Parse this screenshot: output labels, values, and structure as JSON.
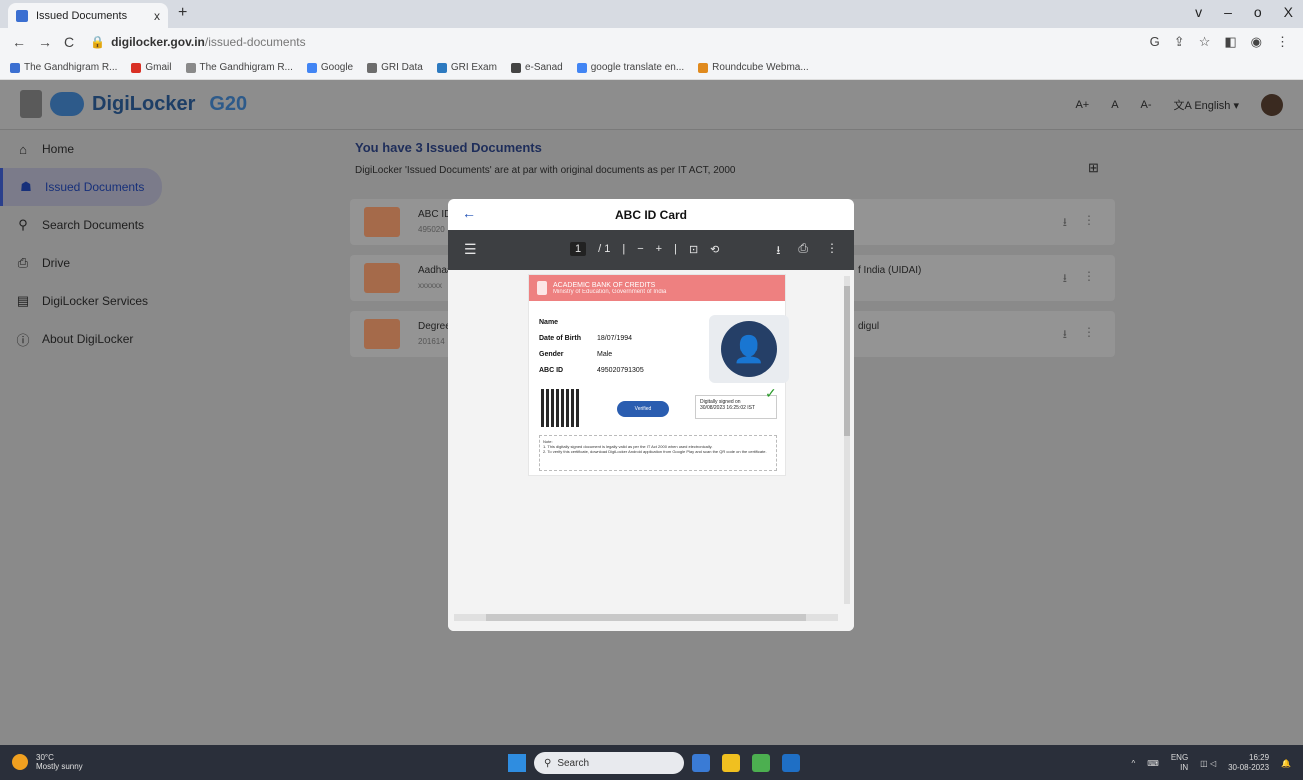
{
  "browser": {
    "tab_title": "Issued Documents",
    "tab_close": "x",
    "new_tab": "+",
    "window_controls": [
      "v",
      "–",
      "o",
      "X"
    ],
    "url_host": "digilocker.gov.in",
    "url_path": "/issued-documents",
    "bookmarks": [
      {
        "label": "The Gandhigram R...",
        "color": "#3b6fd1"
      },
      {
        "label": "Gmail",
        "color": "#d93025"
      },
      {
        "label": "The Gandhigram R...",
        "color": "#8a8a8a"
      },
      {
        "label": "Google",
        "color": "#4285f4"
      },
      {
        "label": "GRI Data",
        "color": "#6d6d6d"
      },
      {
        "label": "GRI Exam",
        "color": "#2d7ac0"
      },
      {
        "label": "e-Sanad",
        "color": "#444444"
      },
      {
        "label": "google translate en...",
        "color": "#4285f4"
      },
      {
        "label": "Roundcube Webma...",
        "color": "#e08a1e"
      }
    ]
  },
  "header": {
    "brand": "DigiLocker",
    "g20": "G20",
    "font_large": "A+",
    "font_normal": "A",
    "font_small": "A-",
    "language": "English"
  },
  "sidebar": {
    "items": [
      {
        "label": "Home",
        "icon": "⌂"
      },
      {
        "label": "Issued Documents",
        "icon": "☗"
      },
      {
        "label": "Search Documents",
        "icon": "⚲"
      },
      {
        "label": "Drive",
        "icon": "⎙"
      },
      {
        "label": "DigiLocker Services",
        "icon": "▤"
      },
      {
        "label": "About DigiLocker",
        "icon": "ⓘ"
      }
    ]
  },
  "main": {
    "heading": "You have 3 Issued Documents",
    "subtext": "DigiLocker 'Issued Documents' are at par with original documents as per IT ACT, 2000",
    "documents": [
      {
        "name": "ABC ID",
        "sub": "495020",
        "right": ""
      },
      {
        "name": "Aadhaar",
        "sub": "xxxxxx",
        "right": "f India (UIDAI)"
      },
      {
        "name": "Degree",
        "sub": "201614",
        "right": "digul"
      }
    ]
  },
  "modal": {
    "title": "ABC ID Card",
    "back": "←",
    "pdf": {
      "page_current": "1",
      "page_total": "/ 1",
      "zoom_out": "−",
      "zoom_in": "+"
    },
    "card": {
      "org": "ACADEMIC BANK OF CREDITS",
      "ministry": "Ministry of Education, Government of India",
      "name_label": "Name",
      "dob_label": "Date of Birth",
      "dob": "18/07/1994",
      "gender_label": "Gender",
      "gender": "Male",
      "abc_label": "ABC ID",
      "abc_id": "495020791305",
      "verified": "Verified",
      "signed_line1": "Digitally signed on",
      "signed_line2": "30/08/2023 16:25:02 IST",
      "note_title": "Note:",
      "note_1": "1. This digitally signed document is legally valid as per the IT Act 2000 when used electronically.",
      "note_2": "2. To verify this certificate, download DigiLocker Android application from Google Play and scan the QR code on the certificate."
    }
  },
  "taskbar": {
    "temp": "30°C",
    "weather": "Mostly sunny",
    "search_placeholder": "Search",
    "lang": "ENG",
    "region": "IN",
    "time": "16:29",
    "date": "30-08-2023"
  }
}
